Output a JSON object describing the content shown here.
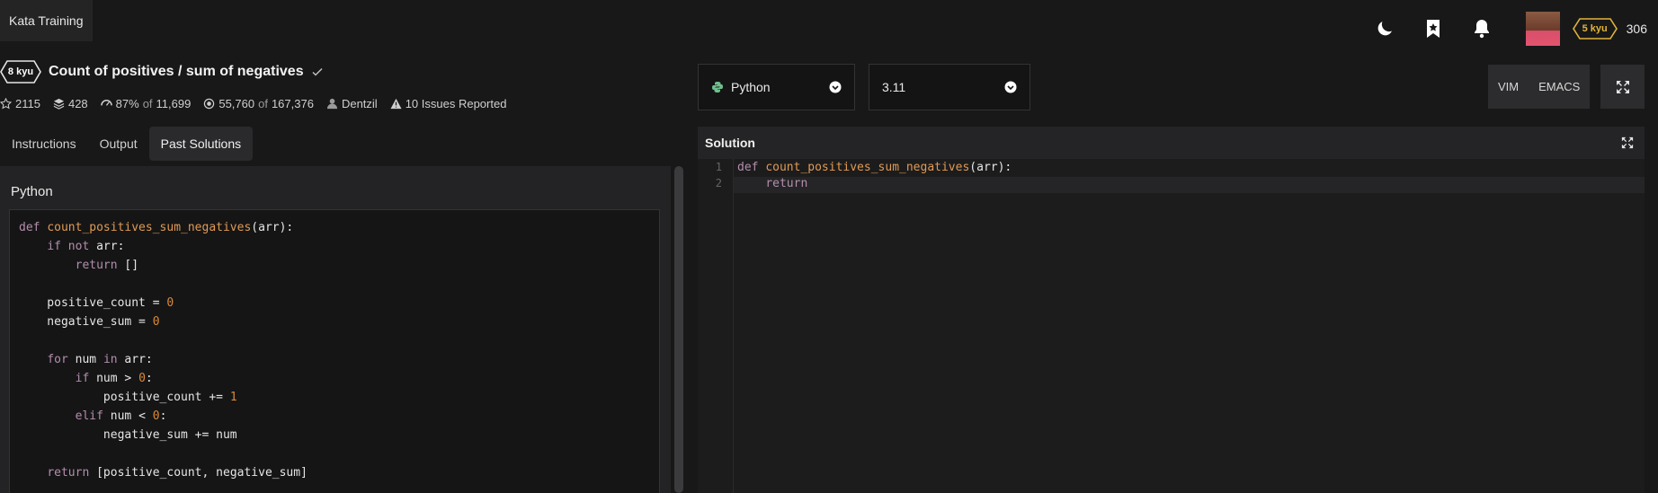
{
  "window": {
    "tab_title": "Kata Training"
  },
  "topbar": {
    "icons": [
      "moon-icon",
      "bookmark-star-icon",
      "bell-icon"
    ],
    "rank": "5 kyu",
    "honor": "306",
    "rank_color": "#e0b43a"
  },
  "kata": {
    "kyu": "8 kyu",
    "title": "Count of positives / sum of negatives",
    "stats": {
      "stars": "2115",
      "collections": "428",
      "satisfaction": "87%",
      "satisfaction_of": "of",
      "satisfaction_total": "11,699",
      "completed": "55,760",
      "completed_of": "of",
      "completed_total": "167,376",
      "author": "Dentzil",
      "issues": "10 Issues Reported"
    }
  },
  "tabs": [
    {
      "label": "Instructions"
    },
    {
      "label": "Output"
    },
    {
      "label": "Past Solutions"
    }
  ],
  "past_solution": {
    "language": "Python",
    "code": [
      "def count_positives_sum_negatives(arr):",
      "    if not arr:",
      "        return []",
      "",
      "    positive_count = 0",
      "    negative_sum = 0",
      "",
      "    for num in arr:",
      "        if num > 0:",
      "            positive_count += 1",
      "        elif num < 0:",
      "            negative_sum += num",
      "",
      "    return [positive_count, negative_sum]"
    ]
  },
  "editor": {
    "language_select": "Python",
    "version_select": "3.11",
    "modes": [
      "VIM",
      "EMACS"
    ],
    "header": "Solution",
    "line_numbers": [
      "1",
      "2"
    ],
    "code": [
      "def count_positives_sum_negatives(arr):",
      "    return"
    ]
  }
}
